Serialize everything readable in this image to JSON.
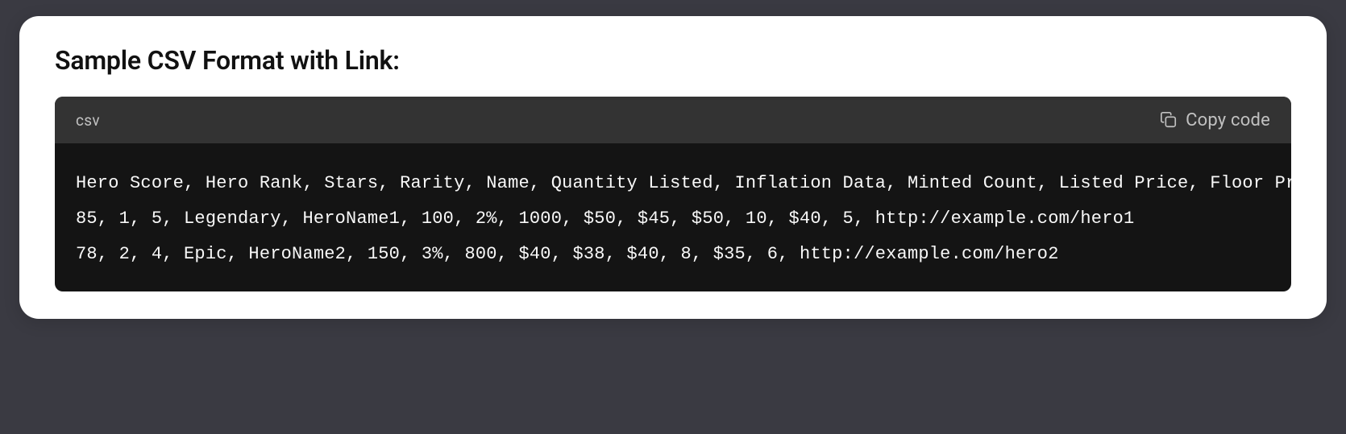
{
  "title": "Sample CSV Format with Link:",
  "code": {
    "language": "csv",
    "copy_label": "Copy code",
    "content": "Hero Score, Hero Rank, Stars, Rarity, Name, Quantity Listed, Inflation Data, Minted Count, Listed Price, Floor Price, Avg Price, Sales Count, Last Sale, Owners, Link\n85, 1, 5, Legendary, HeroName1, 100, 2%, 1000, $50, $45, $50, 10, $40, 5, http://example.com/hero1\n78, 2, 4, Epic, HeroName2, 150, 3%, 800, $40, $38, $40, 8, $35, 6, http://example.com/hero2"
  }
}
